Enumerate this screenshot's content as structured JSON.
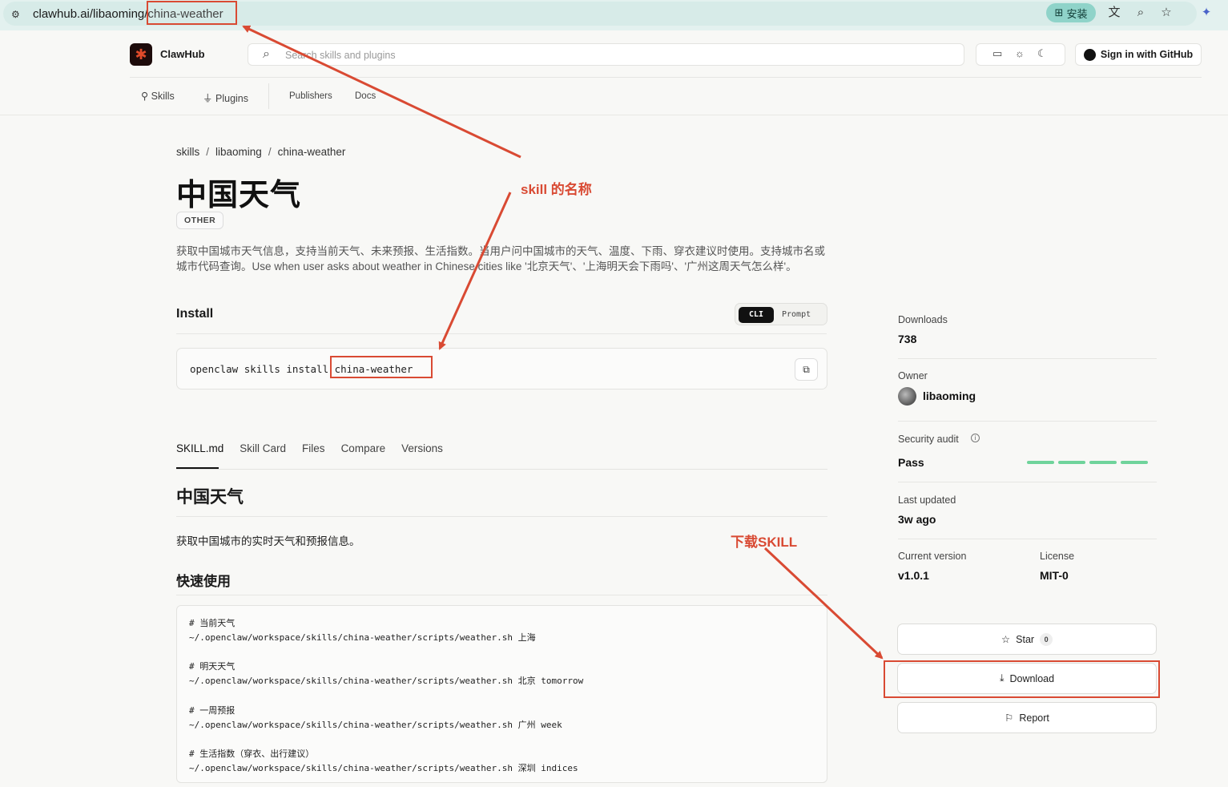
{
  "browser": {
    "url_host": "clawhub.ai/libaoming/",
    "url_path": "china-weather",
    "install_label": "安装"
  },
  "header": {
    "brand": "ClawHub",
    "search_placeholder": "Search skills and plugins",
    "signin_label": "Sign in with GitHub"
  },
  "nav": {
    "skills": "Skills",
    "plugins": "Plugins",
    "publishers": "Publishers",
    "docs": "Docs"
  },
  "breadcrumb": [
    "skills",
    "libaoming",
    "china-weather"
  ],
  "skill": {
    "title": "中国天气",
    "tag": "OTHER",
    "description": "获取中国城市天气信息，支持当前天气、未来预报、生活指数。当用户问中国城市的天气、温度、下雨、穿衣建议时使用。支持城市名或城市代码查询。Use when user asks about weather in Chinese cities like '北京天气'、'上海明天会下雨吗'、'广州这周天气怎么样'。"
  },
  "install": {
    "heading": "Install",
    "mode_cli": "CLI",
    "mode_prompt": "Prompt",
    "command_prefix": "openclaw skills install ",
    "command_slug": "china-weather"
  },
  "tabs": [
    "SKILL.md",
    "Skill Card",
    "Files",
    "Compare",
    "Versions"
  ],
  "readme": {
    "h1": "中国天气",
    "intro": "获取中国城市的实时天气和预报信息。",
    "h2": "快速使用",
    "code": [
      "# 当前天气",
      "~/.openclaw/workspace/skills/china-weather/scripts/weather.sh 上海",
      "",
      "# 明天天气",
      "~/.openclaw/workspace/skills/china-weather/scripts/weather.sh 北京 tomorrow",
      "",
      "# 一周预报",
      "~/.openclaw/workspace/skills/china-weather/scripts/weather.sh 广州 week",
      "",
      "# 生活指数（穿衣、出行建议）",
      "~/.openclaw/workspace/skills/china-weather/scripts/weather.sh 深圳 indices"
    ]
  },
  "sidebar": {
    "downloads_label": "Downloads",
    "downloads_value": "738",
    "owner_label": "Owner",
    "owner_value": "libaoming",
    "audit_label": "Security audit",
    "audit_value": "Pass",
    "updated_label": "Last updated",
    "updated_value": "3w ago",
    "version_label": "Current version",
    "version_value": "v1.0.1",
    "license_label": "License",
    "license_value": "MIT-0",
    "star_label": "Star",
    "star_count": "0",
    "download_label": "Download",
    "report_label": "Report"
  },
  "annotations": {
    "skill_name": "skill 的名称",
    "download_skill": "下载SKILL",
    "color": "#d94a33"
  }
}
